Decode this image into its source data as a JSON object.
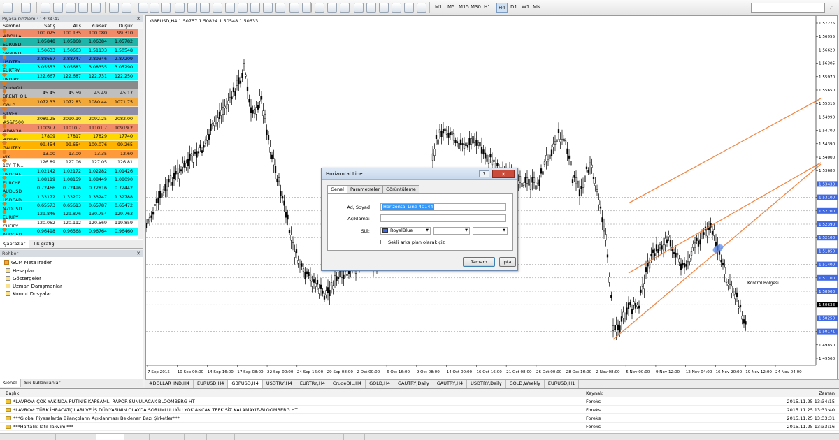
{
  "toolbar": {
    "timeframes": [
      "M1",
      "M5",
      "M15",
      "M30",
      "H1",
      "H4",
      "D1",
      "W1",
      "MN"
    ],
    "active_timeframe": "H4"
  },
  "market_watch": {
    "title": "Piyasa Gözlemi: 13:34:42",
    "columns": [
      "Sembol",
      "Satış",
      "Alış",
      "Yüksek",
      "Düşük"
    ],
    "rows": [
      {
        "sym": "#DOLLA...",
        "bid": "100.025",
        "ask": "100.135",
        "high": "100.080",
        "low": "99.310",
        "bg": "#f08b6a"
      },
      {
        "sym": "EURUSD",
        "bid": "1.05848",
        "ask": "1.05868",
        "high": "1.06384",
        "low": "1.05782",
        "bg": "#1fb5a8"
      },
      {
        "sym": "GBPUSD",
        "bid": "1.50633",
        "ask": "1.50663",
        "high": "1.51133",
        "low": "1.50548",
        "bg": "#00ffff"
      },
      {
        "sym": "USDTRY",
        "bid": "2.88667",
        "ask": "2.88747",
        "high": "2.89346",
        "low": "2.87209",
        "bg": "#3b86e0"
      },
      {
        "sym": "EURTRY",
        "bid": "3.05553",
        "ask": "3.05683",
        "high": "3.08355",
        "low": "3.05290",
        "bg": "#00ffff"
      },
      {
        "sym": "USDJPY",
        "bid": "122.667",
        "ask": "122.687",
        "high": "122.731",
        "low": "122.250",
        "bg": "#00ffff"
      },
      {
        "sym": "CrudeOIL",
        "bid": "",
        "ask": "",
        "high": "",
        "low": "",
        "bg": "#8a8a8a"
      },
      {
        "sym": "BRENT_OIL",
        "bid": "45.45",
        "ask": "45.59",
        "high": "45.49",
        "low": "45.17",
        "bg": "#bfbfbf"
      },
      {
        "sym": "GOLD",
        "bid": "1072.33",
        "ask": "1072.83",
        "high": "1080.44",
        "low": "1071.75",
        "bg": "#f3a83a"
      },
      {
        "sym": "SILVER",
        "bid": "",
        "ask": "",
        "high": "",
        "low": "",
        "bg": "#8e8ea8"
      },
      {
        "sym": "#S&P500",
        "bid": "2089.25",
        "ask": "2090.10",
        "high": "2092.25",
        "low": "2082.00",
        "bg": "#ffe14d"
      },
      {
        "sym": "#DAX30",
        "bid": "11009.7",
        "ask": "11010.7",
        "high": "11101.7",
        "low": "10919.2",
        "bg": "#f08b6a"
      },
      {
        "sym": "#DJI30",
        "bid": "17809",
        "ask": "17817",
        "high": "17829",
        "low": "17740",
        "bg": "#ffd800"
      },
      {
        "sym": "GAUTRY",
        "bid": "99.454",
        "ask": "99.654",
        "high": "100.076",
        "low": "99.265",
        "bg": "#ffb300"
      },
      {
        "sym": "VIX",
        "bid": "13.00",
        "ask": "13.00",
        "high": "13.35",
        "low": "12.60",
        "bg": "#ff9a3a"
      },
      {
        "sym": "10Y_T-N...",
        "bid": "126.89",
        "ask": "127.06",
        "high": "127.05",
        "low": "126.81",
        "bg": "#ffffff"
      },
      {
        "sym": "USDCHF",
        "bid": "1.02142",
        "ask": "1.02172",
        "high": "1.02282",
        "low": "1.01426",
        "bg": "#00ffff"
      },
      {
        "sym": "EURCHF",
        "bid": "1.08119",
        "ask": "1.08159",
        "high": "1.08449",
        "low": "1.08090",
        "bg": "#00ffff"
      },
      {
        "sym": "AUDUSD",
        "bid": "0.72466",
        "ask": "0.72496",
        "high": "0.72816",
        "low": "0.72442",
        "bg": "#00ffff"
      },
      {
        "sym": "USDCAD",
        "bid": "1.33172",
        "ask": "1.33202",
        "high": "1.33247",
        "low": "1.32788",
        "bg": "#00ffff"
      },
      {
        "sym": "NZDUSD",
        "bid": "0.65573",
        "ask": "0.65613",
        "high": "0.65787",
        "low": "0.65472",
        "bg": "#00ffff"
      },
      {
        "sym": "EURJPY",
        "bid": "129.846",
        "ask": "129.876",
        "high": "130.754",
        "low": "129.763",
        "bg": "#00ffff"
      },
      {
        "sym": "CHFJPY",
        "bid": "120.062",
        "ask": "120.112",
        "high": "120.569",
        "low": "119.859",
        "bg": "#ffffff"
      },
      {
        "sym": "AUDCAD",
        "bid": "0.96498",
        "ask": "0.96568",
        "high": "0.96764",
        "low": "0.96460",
        "bg": "#00ffff"
      }
    ],
    "tabs": [
      "Çaprazlar",
      "Tik grafiği"
    ]
  },
  "navigator": {
    "title": "Rehber",
    "items": [
      "GCM MetaTrader",
      "Hesaplar",
      "Göstergeler",
      "Uzman Danışmanlar",
      "Komut Dosyaları"
    ],
    "tabs": [
      "Genel",
      "Sık kullanılanlar"
    ]
  },
  "chart": {
    "header": "GBPUSD,H4  1.50757 1.50824 1.50548 1.50633",
    "label": "Kontrol Bölgesi",
    "price_labels": [
      "1.57275",
      "1.56955",
      "1.56620",
      "1.56305",
      "1.55970",
      "1.55650",
      "1.55315",
      "1.54990",
      "1.54700",
      "1.54390",
      "1.54000",
      "1.53680",
      "1.53430",
      "1.53100",
      "1.52700",
      "1.52390",
      "1.52100",
      "1.51850",
      "1.51400",
      "1.51100",
      "1.50900",
      "1.50633",
      "1.50250",
      "1.50171",
      "1.49850",
      "1.49560"
    ],
    "time_labels": [
      "7 Sep 2015",
      "10 Sep 00:00",
      "14 Sep 16:00",
      "17 Sep 08:00",
      "22 Sep 00:00",
      "24 Sep 16:00",
      "29 Sep 08:00",
      "2 Oct 00:00",
      "6 Oct 16:00",
      "9 Oct 08:00",
      "14 Oct 00:00",
      "16 Oct 16:00",
      "21 Oct 08:00",
      "26 Oct 00:00",
      "28 Oct 16:00",
      "2 Nov 08:00",
      "5 Nov 00:00",
      "9 Nov 12:00",
      "12 Nov 04:00",
      "16 Nov 20:00",
      "19 Nov 12:00",
      "24 Nov 04:00"
    ],
    "tabs": [
      "#DOLLAR_IND,H4",
      "EURUSD,H4",
      "GBPUSD,H4",
      "USDTRY,H4",
      "EURTRY,H4",
      "CrudeOIL,H4",
      "GOLD,H4",
      "GAUTRY,Daily",
      "GAUTRY,H4",
      "USDTRY,Daily",
      "GOLD,Weekly",
      "EURUSD,H1"
    ],
    "active_tab": "GBPUSD,H4"
  },
  "dialog": {
    "title": "Horizontal Line",
    "help": "?",
    "close": "✕",
    "tabs": [
      "Genel",
      "Parametreler",
      "Görüntüleme"
    ],
    "name_label": "Ad, Soyad",
    "name_value": "Horizontal Line 40144",
    "desc_label": "Açıklama:",
    "style_label": "Stil:",
    "color_value": "RoyalBlue",
    "background_label": "Sekli arka plan olarak çiz",
    "ok": "Tamam",
    "cancel": "İptal"
  },
  "news": {
    "columns": [
      "Başlık",
      "Kaynak",
      "Zaman"
    ],
    "rows": [
      {
        "title": "*LAVROV: ÇOK YAKINDA PUTİN'E KAPSAMLI RAPOR SUNULACAK-BLOOMBERG HT",
        "source": "Foreks",
        "time": "2015.11.25 13:34:15"
      },
      {
        "title": "*LAVROV: TÜRK İHRACATÇILARI VE İŞ DÜNYASININ OLAYDA SORUMLULUĞU YOK ANCAK TEPKİSİZ KALAMAYIZ-BLOOMBERG HT",
        "source": "Foreks",
        "time": "2015.11.25 13:33:40"
      },
      {
        "title": "***Global Piyasalarda Bilançoların Açıklanması Beklenen Bazı Şirketler***",
        "source": "Foreks",
        "time": "2015.11.25 13:33:31"
      },
      {
        "title": "***Haftalık Tatil Takvimi***",
        "source": "Foreks",
        "time": "2015.11.25 13:33:16"
      }
    ]
  },
  "colors": {
    "up_line": "#f08a4b",
    "candle": "#000000",
    "accent": "#3399ff"
  }
}
